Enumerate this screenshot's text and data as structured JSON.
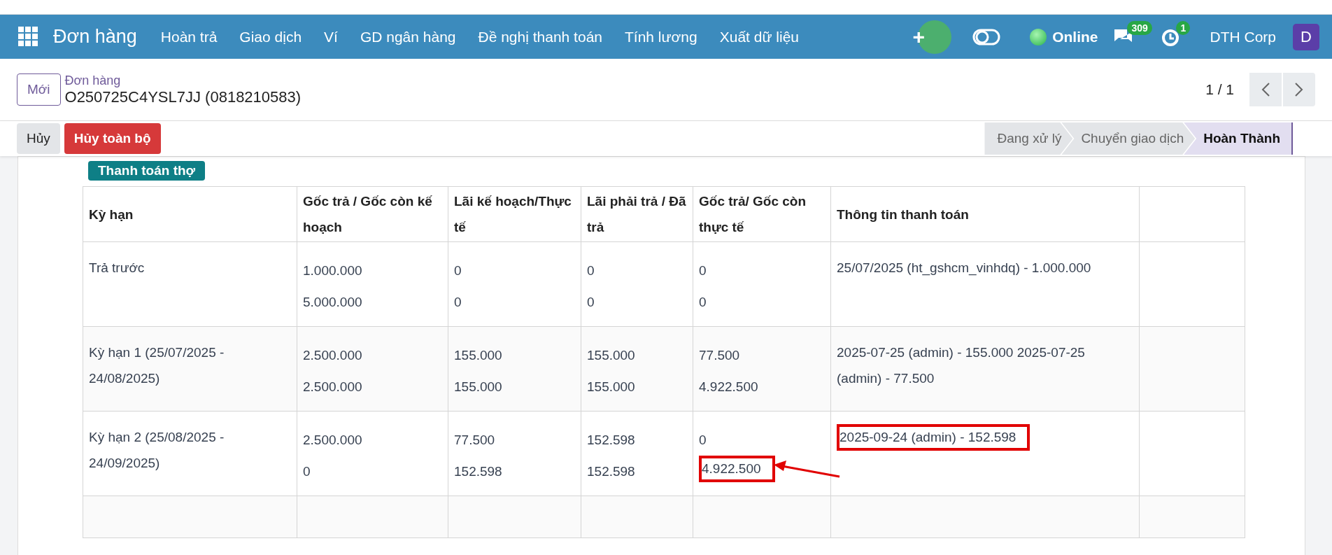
{
  "navbar": {
    "brand": "Đơn hàng",
    "menu": [
      "Hoàn trả",
      "Giao dịch",
      "Ví",
      "GD ngân hàng",
      "Đề nghị thanh toán",
      "Tính lương",
      "Xuất dữ liệu"
    ],
    "plus": "+",
    "status": "Online",
    "messages_count": "309",
    "activities_count": "1",
    "company": "DTH Corp",
    "avatar": "D"
  },
  "control_panel": {
    "new_button": "Mới",
    "breadcrumb": "Đơn hàng",
    "record": "O250725C4YSL7JJ (0818210583)",
    "pager": "1 / 1"
  },
  "actions": {
    "buttons": [
      {
        "label": "Hủy",
        "kind": "secondary"
      },
      {
        "label": "Hủy toàn bộ",
        "kind": "danger"
      }
    ],
    "stages": [
      {
        "label": "Đang xử lý",
        "selected": false
      },
      {
        "label": "Chuyển giao dịch",
        "selected": false
      },
      {
        "label": "Hoàn Thành",
        "selected": true
      }
    ]
  },
  "form": {
    "pay_button": "Thanh toán thợ",
    "table": {
      "columns": [
        "Kỳ hạn",
        "Gốc trả / Gốc còn kế hoạch",
        "Lãi kế hoạch/Thực tế",
        "Lãi phải trả / Đã trả",
        "Gốc trả/ Gốc còn thực tế",
        "Thông tin thanh toán"
      ],
      "rows": [
        {
          "cells": [
            [
              {
                "text": "Trả trước",
                "boxed": false
              }
            ],
            [
              {
                "text": "1.000.000",
                "boxed": false
              },
              {
                "text": "5.000.000",
                "boxed": false
              }
            ],
            [
              {
                "text": "0",
                "boxed": false
              },
              {
                "text": "0",
                "boxed": false
              }
            ],
            [
              {
                "text": "0",
                "boxed": false
              },
              {
                "text": "0",
                "boxed": false
              }
            ],
            [
              {
                "text": "0",
                "boxed": false
              },
              {
                "text": "0",
                "boxed": false
              }
            ],
            [
              {
                "text": "25/07/2025 (ht_gshcm_vinhdq) - 1.000.000",
                "boxed": false
              }
            ]
          ]
        },
        {
          "cells": [
            [
              {
                "text": "Kỳ hạn 1 (25/07/2025 - 24/08/2025)",
                "boxed": false
              }
            ],
            [
              {
                "text": "2.500.000",
                "boxed": false
              },
              {
                "text": "2.500.000",
                "boxed": false
              }
            ],
            [
              {
                "text": "155.000",
                "boxed": false
              },
              {
                "text": "155.000",
                "boxed": false
              }
            ],
            [
              {
                "text": "155.000",
                "boxed": false
              },
              {
                "text": "155.000",
                "boxed": false
              }
            ],
            [
              {
                "text": "77.500",
                "boxed": false
              },
              {
                "text": "4.922.500",
                "boxed": false
              }
            ],
            [
              {
                "text": "2025-07-25 (admin) - 155.000 2025-07-25 (admin) - 77.500",
                "boxed": false
              }
            ]
          ]
        },
        {
          "cells": [
            [
              {
                "text": "Kỳ hạn 2 (25/08/2025 - 24/09/2025)",
                "boxed": false
              }
            ],
            [
              {
                "text": "2.500.000",
                "boxed": false
              },
              {
                "text": "0",
                "boxed": false
              }
            ],
            [
              {
                "text": "77.500",
                "boxed": false
              },
              {
                "text": "152.598",
                "boxed": false
              }
            ],
            [
              {
                "text": "152.598",
                "boxed": false
              },
              {
                "text": "152.598",
                "boxed": false
              }
            ],
            [
              {
                "text": "0",
                "boxed": false
              },
              {
                "text": "4.922.500",
                "boxed": true,
                "arrow": true
              }
            ],
            [
              {
                "text": "2025-09-24 (admin) - 152.598",
                "boxed": true,
                "arrow": false
              }
            ]
          ]
        }
      ]
    }
  }
}
